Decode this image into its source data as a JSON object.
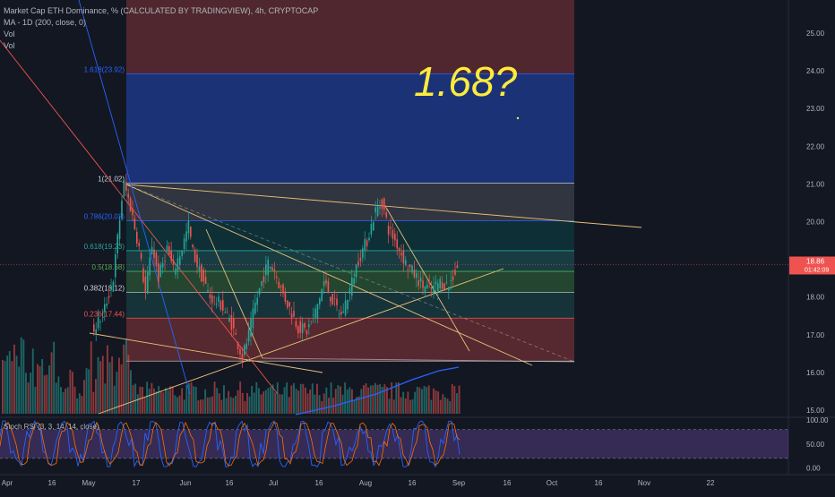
{
  "header": {
    "title": "Market Cap ETH Dominance, % (CALCULATED BY TRADINGVIEW), 4h, CRYPTOCAP",
    "ma": "MA - 1D (200, close, 0)",
    "vol1": "Vol",
    "vol2": "Vol"
  },
  "annotation": "1.68?",
  "colors": {
    "up": "#26a69a",
    "down": "#ef5350",
    "annotation": "#ffeb3b",
    "rsi_band": "#7e57c2",
    "ma": "#2962ff"
  },
  "chart_data": [
    {
      "type": "candlestick",
      "name": "price",
      "yaxis": {
        "ticks": [
          "25.00",
          "24.00",
          "23.00",
          "22.00",
          "21.00",
          "20.00",
          "19.00",
          "18.00",
          "17.00",
          "16.00",
          "15.00"
        ],
        "ylim": [
          14.8,
          25.7
        ]
      },
      "xaxis": {
        "ticks": [
          "Apr",
          "16",
          "May",
          "17",
          "Jun",
          "16",
          "Jul",
          "16",
          "Aug",
          "16",
          "Sep",
          "16",
          "Oct",
          "16",
          "Nov",
          "22"
        ]
      },
      "last_price": "18.86",
      "countdown": "01:42:09",
      "path": [
        [
          0,
          17.1
        ],
        [
          5,
          17.5
        ],
        [
          10,
          18.5
        ],
        [
          14,
          20.6
        ],
        [
          15,
          21.0
        ],
        [
          18,
          20.4
        ],
        [
          22,
          19.3
        ],
        [
          25,
          18.1
        ],
        [
          28,
          19.4
        ],
        [
          31,
          18.5
        ],
        [
          35,
          19.3
        ],
        [
          38,
          18.7
        ],
        [
          42,
          19.3
        ],
        [
          45,
          19.9
        ],
        [
          47,
          19.2
        ],
        [
          50,
          18.7
        ],
        [
          55,
          18.0
        ],
        [
          60,
          17.8
        ],
        [
          65,
          17.3
        ],
        [
          70,
          16.4
        ],
        [
          73,
          17.0
        ],
        [
          76,
          17.8
        ],
        [
          79,
          18.4
        ],
        [
          82,
          18.9
        ],
        [
          85,
          18.7
        ],
        [
          88,
          18.2
        ],
        [
          92,
          17.7
        ],
        [
          96,
          17.2
        ],
        [
          100,
          17.1
        ],
        [
          104,
          17.6
        ],
        [
          108,
          18.4
        ],
        [
          112,
          17.9
        ],
        [
          116,
          17.5
        ],
        [
          120,
          18.2
        ],
        [
          124,
          19.0
        ],
        [
          128,
          19.5
        ],
        [
          132,
          20.3
        ],
        [
          135,
          20.5
        ],
        [
          138,
          19.8
        ],
        [
          142,
          19.4
        ],
        [
          146,
          18.9
        ],
        [
          150,
          18.6
        ],
        [
          154,
          18.3
        ],
        [
          158,
          18.2
        ],
        [
          162,
          18.4
        ],
        [
          166,
          18.3
        ],
        [
          170,
          18.8
        ]
      ],
      "fib_levels": [
        {
          "label": "1.618(23.92)",
          "value": 23.92
        },
        {
          "label": "1(21.02)",
          "value": 21.02
        },
        {
          "label": "0.786(20.02)",
          "value": 20.02
        },
        {
          "label": "0.618(19.23)",
          "value": 19.23
        },
        {
          "label": "0.5(18.68)",
          "value": 18.68
        },
        {
          "label": "0.382(18.12)",
          "value": 18.12
        },
        {
          "label": "0.236(17.44)",
          "value": 17.44
        },
        {
          "label": "",
          "value": 16.3
        }
      ]
    },
    {
      "type": "line",
      "name": "Stoch RSI",
      "label": "Stoch RSI (3, 3, 14, 14, close)",
      "yaxis": {
        "ticks": [
          "100.00",
          "50.00",
          "0.00"
        ],
        "ylim": [
          0,
          100
        ]
      },
      "band": [
        20,
        80
      ]
    }
  ]
}
